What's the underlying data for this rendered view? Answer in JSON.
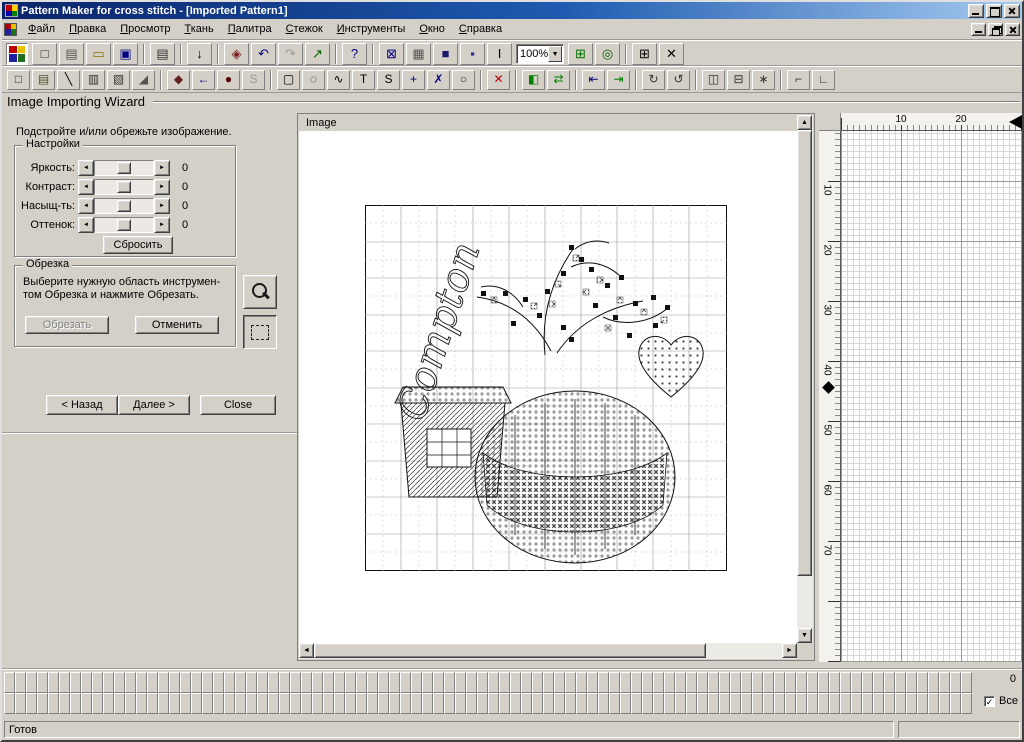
{
  "window": {
    "title": "Pattern Maker for cross stitch - [Imported Pattern1]",
    "status": "Готов"
  },
  "icons": {
    "up": "▲",
    "down": "▼",
    "left": "◄",
    "right": "►",
    "check": "✓"
  },
  "menu": [
    "Файл",
    "Правка",
    "Просмотр",
    "Ткань",
    "Палитра",
    "Стежок",
    "Инструменты",
    "Окно",
    "Справка"
  ],
  "toolbar1": [
    {
      "app": true,
      "n": "app-icon"
    },
    {
      "n": "new-pattern-button",
      "g": "□",
      "c": "#333333"
    },
    {
      "n": "paste-picture-button",
      "g": "▤",
      "c": "#555555"
    },
    {
      "n": "open-button",
      "g": "▭",
      "c": "#8a6d00"
    },
    {
      "n": "save-button",
      "g": "▣",
      "c": "#000080"
    },
    {
      "sep": true
    },
    {
      "n": "print-button",
      "g": "▤",
      "c": "#333333"
    },
    {
      "sep": true
    },
    {
      "n": "import-export-button",
      "g": "↓",
      "c": "#000000"
    },
    {
      "sep": true
    },
    {
      "n": "fabric-button",
      "g": "◈",
      "c": "#7a2020"
    },
    {
      "n": "undo-button",
      "g": "↶",
      "c": "#000080"
    },
    {
      "n": "redo-button",
      "g": "↷",
      "c": "#9a9a9a"
    },
    {
      "n": "statistics-button",
      "g": "↗",
      "c": "#006000"
    },
    {
      "sep": true
    },
    {
      "n": "help-button",
      "g": "?",
      "c": "#000080"
    },
    {
      "sep": true
    },
    {
      "n": "view-full-stitches-button",
      "g": "⊠",
      "c": "#000080"
    },
    {
      "n": "view-as-picture-button",
      "g": "▦",
      "c": "#555555"
    },
    {
      "n": "view-solid-button",
      "g": "■",
      "c": "#1a1a6e"
    },
    {
      "n": "view-color-blocks-button",
      "g": "▪",
      "c": "#2e2ea0"
    },
    {
      "n": "view-information-button",
      "g": "I",
      "c": "#000000"
    },
    {
      "combo": true,
      "n": "zoom-select",
      "value": "100%"
    },
    {
      "n": "zoom-to-fit-button",
      "g": "⊞",
      "c": "#007000"
    },
    {
      "n": "zoom-area-button",
      "g": "◎",
      "c": "#006000"
    },
    {
      "sep": true
    },
    {
      "n": "show-grid-button",
      "g": "⊞",
      "c": "#000000"
    },
    {
      "n": "close-pattern-button",
      "g": "✕",
      "c": "#000000"
    }
  ],
  "toolbar2": [
    {
      "n": "new-small-button",
      "g": "□",
      "c": "#333333"
    },
    {
      "n": "import-small-button",
      "g": "▤",
      "c": "#555333"
    },
    {
      "n": "line-tool-button",
      "g": "╲",
      "c": "#000000"
    },
    {
      "n": "full-stitch-tool-button",
      "g": "▥",
      "c": "#333333"
    },
    {
      "n": "half-stitch-tool-button",
      "g": "▧",
      "c": "#333333"
    },
    {
      "n": "quarter-stitch-tool-button",
      "g": "◢",
      "c": "#555555"
    },
    {
      "sep": true
    },
    {
      "n": "back-stitch-tool-button",
      "g": "◆",
      "c": "#602020"
    },
    {
      "n": "undo-small-button",
      "g": "←",
      "c": "#000080"
    },
    {
      "n": "french-knot-tool-button",
      "g": "●",
      "c": "#500000"
    },
    {
      "n": "symbols-button",
      "g": "S",
      "c": "#9a9a9a"
    },
    {
      "sep": true
    },
    {
      "n": "select-rectangle-button",
      "g": "▢",
      "c": "#000000"
    },
    {
      "n": "select-ellipse-button",
      "g": "◌",
      "c": "#000000"
    },
    {
      "n": "select-freehand-button",
      "g": "∿",
      "c": "#000000"
    },
    {
      "n": "text-tool-button",
      "g": "T",
      "c": "#000000"
    },
    {
      "n": "symbol-tool-button",
      "g": "S",
      "c": "#000000"
    },
    {
      "n": "move-tool-button",
      "g": "+",
      "c": "#000080"
    },
    {
      "n": "edit-tool-button",
      "g": "✗",
      "c": "#000080"
    },
    {
      "n": "zoom-small-button",
      "g": "○",
      "c": "#00335a"
    },
    {
      "sep": true
    },
    {
      "n": "delete-button",
      "g": "✕",
      "c": "#c00000"
    },
    {
      "sep": true
    },
    {
      "n": "fill-color-button",
      "g": "◧",
      "c": "#008000"
    },
    {
      "n": "replace-color-button",
      "g": "⇄",
      "c": "#008000"
    },
    {
      "sep": true
    },
    {
      "n": "goto-marker-button",
      "g": "⇤",
      "c": "#000080"
    },
    {
      "n": "set-marker-button",
      "g": "⇥",
      "c": "#008000"
    },
    {
      "sep": true
    },
    {
      "n": "rotate-cw-button",
      "g": "↻",
      "c": "#333333"
    },
    {
      "n": "rotate-ccw-button",
      "g": "↺",
      "c": "#333333"
    },
    {
      "sep": true
    },
    {
      "n": "mirror-horizontal-button",
      "g": "◫",
      "c": "#333333"
    },
    {
      "n": "mirror-vertical-button",
      "g": "⊟",
      "c": "#333333"
    },
    {
      "n": "center-pattern-button",
      "g": "∗",
      "c": "#333333"
    },
    {
      "sep": true
    },
    {
      "n": "column-guide-button",
      "g": "⌐",
      "c": "#333333"
    },
    {
      "n": "frame-corner-button",
      "g": "∟",
      "c": "#333333"
    }
  ],
  "wizard": {
    "title": "Image Importing Wizard",
    "instruction": "Подстройте и/или обрежьте изображение.",
    "settings": {
      "title": "Настройки",
      "sliders": [
        {
          "label": "Яркость:",
          "value": "0"
        },
        {
          "label": "Контраст:",
          "value": "0"
        },
        {
          "label": "Насыщ-ть:",
          "value": "0"
        },
        {
          "label": "Оттенок:",
          "value": "0"
        }
      ],
      "reset": "Сбросить"
    },
    "crop": {
      "title": "Обрезка",
      "line1": "Выберите нужную область инструмен-",
      "line2": "том Обрезка и нажмите Обрезать.",
      "crop_button": "Обрезать",
      "cancel_button": "Отменить"
    },
    "back": "< Назад",
    "next": "Далее >",
    "close": "Close"
  },
  "preview": {
    "label": "Image",
    "script_text": "Compton"
  },
  "canvas": {
    "ruler_top": [
      "10",
      "20"
    ],
    "ruler_side": [
      "10",
      "20",
      "30",
      "40",
      "50",
      "60",
      "70"
    ]
  },
  "palette": {
    "count": "0",
    "all_label": "Все",
    "rows": 2,
    "cols": 88
  }
}
